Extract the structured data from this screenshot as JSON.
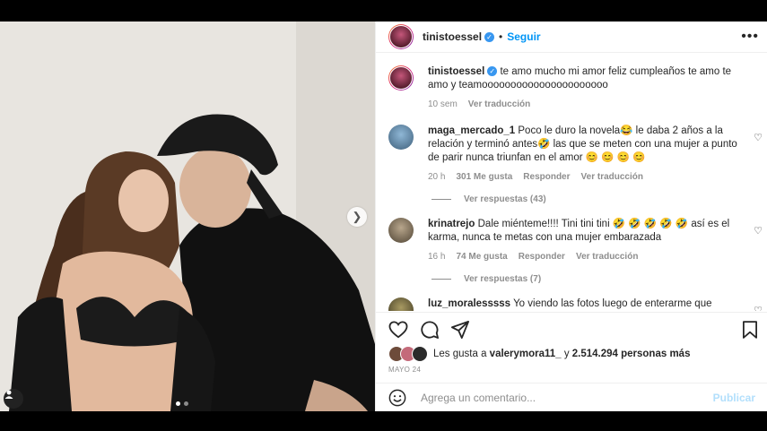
{
  "post": {
    "username": "tinistoessel",
    "follow_label": "Seguir",
    "separator": "•",
    "more_label": "•••"
  },
  "caption": {
    "username": "tinistoessel",
    "text": "te amo mucho mi amor feliz cumpleaños te amo te amo y teamoooooooooooooooooooooo",
    "time": "10 sem",
    "translate": "Ver traducción"
  },
  "comments": [
    {
      "username": "maga_mercado_1",
      "text": "Poco le duro la novela😂 le daba 2 años a la relación y terminó antes🤣 las que se meten con una mujer a punto de parir nunca triunfan en el amor 😊 😊 😊 😊",
      "time": "20 h",
      "likes": "301 Me gusta",
      "reply": "Responder",
      "translate": "Ver traducción",
      "view_replies": "Ver respuestas (43)"
    },
    {
      "username": "krinatrejo",
      "text": "Dale miénteme!!!! Tini tini tini 🤣 🤣 🤣 🤣 🤣 así es el karma, nunca te metas con una mujer embarazada",
      "time": "16 h",
      "likes": "74 Me gusta",
      "reply": "Responder",
      "translate": "Ver traducción",
      "view_replies": "Ver respuestas (7)"
    },
    {
      "username": "luz_moralesssss",
      "text": "Yo viendo las fotos luego de enterarme que terminaron"
    }
  ],
  "likes": {
    "prefix": "Les gusta a",
    "user": "valerymora11_",
    "connector": "y",
    "count": "2.514.294 personas más"
  },
  "date": "MAYO 24",
  "add_comment": {
    "placeholder": "Agrega un comentario...",
    "publish": "Publicar"
  },
  "icons": {
    "more": "more-options-icon",
    "verified": "verified-badge-icon",
    "like": "heart-icon",
    "comment": "comment-icon",
    "share": "share-icon",
    "save": "bookmark-icon",
    "emoji": "emoji-icon",
    "next": "chevron-right-icon",
    "tag": "user-tag-icon"
  },
  "colors": {
    "accent": "#0095f6",
    "publish_disabled": "#b2dffc",
    "verified": "#3897f0",
    "muted": "#8e8e8e"
  },
  "carousel": {
    "total": 2,
    "current": 1
  }
}
